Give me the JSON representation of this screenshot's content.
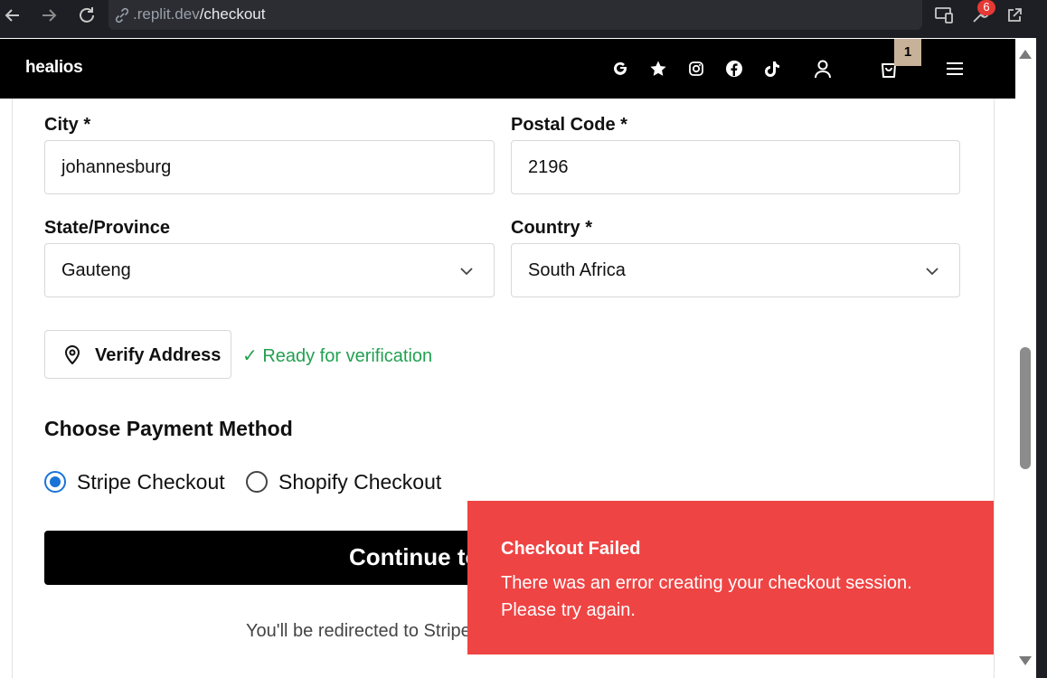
{
  "browser": {
    "url_domain": ".replit.dev",
    "url_path": "/checkout",
    "extensions_badge": "6"
  },
  "header": {
    "logo": "healios",
    "cart_count": "1",
    "icons": [
      "google-icon",
      "star-icon",
      "instagram-icon",
      "facebook-icon",
      "tiktok-icon",
      "user-icon",
      "cart-icon",
      "menu-icon"
    ]
  },
  "form": {
    "city": {
      "label": "City *",
      "value": "johannesburg"
    },
    "postal": {
      "label": "Postal Code *",
      "value": "2196"
    },
    "state": {
      "label": "State/Province",
      "value": "Gauteng"
    },
    "country": {
      "label": "Country *",
      "value": "South Africa"
    },
    "verify_button": "Verify Address",
    "verify_status": "✓ Ready for verification"
  },
  "payment": {
    "title": "Choose Payment Method",
    "options": [
      {
        "label": "Stripe Checkout",
        "selected": true
      },
      {
        "label": "Shopify Checkout",
        "selected": false
      }
    ],
    "continue_label": "Continue to",
    "redirect_note": "You'll be redirected to Stripe"
  },
  "toast": {
    "title": "Checkout Failed",
    "message": "There was an error creating your checkout session. Please try again."
  },
  "colors": {
    "toast_bg": "#ef4444",
    "radio_selected": "#1a73d8",
    "success_text": "#22a050",
    "cart_badge": "#c8b199"
  }
}
